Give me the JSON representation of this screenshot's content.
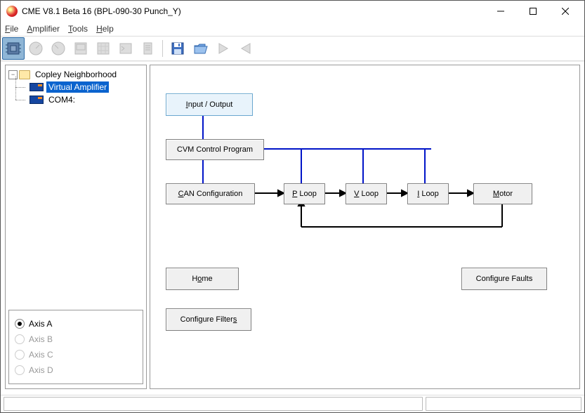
{
  "title": "CME V8.1 Beta 16 (BPL-090-30 Punch_Y)",
  "menu": {
    "file": "File",
    "amplifier": "Amplifier",
    "tools": "Tools",
    "help": "Help"
  },
  "tree": {
    "root": "Copley Neighborhood",
    "n1": "Virtual Amplifier",
    "n2": "COM4:"
  },
  "axis": {
    "a": "Axis A",
    "b": "Axis B",
    "c": "Axis C",
    "d": "Axis D"
  },
  "blocks": {
    "io": "Input / Output",
    "cvm": "CVM Control Program",
    "can": "CAN Configuration",
    "ploop": "P Loop",
    "vloop": "V Loop",
    "iloop": "I Loop",
    "motor": "Motor",
    "home": "Home",
    "faults": "Configure Faults",
    "filters": "Configure Filters"
  }
}
